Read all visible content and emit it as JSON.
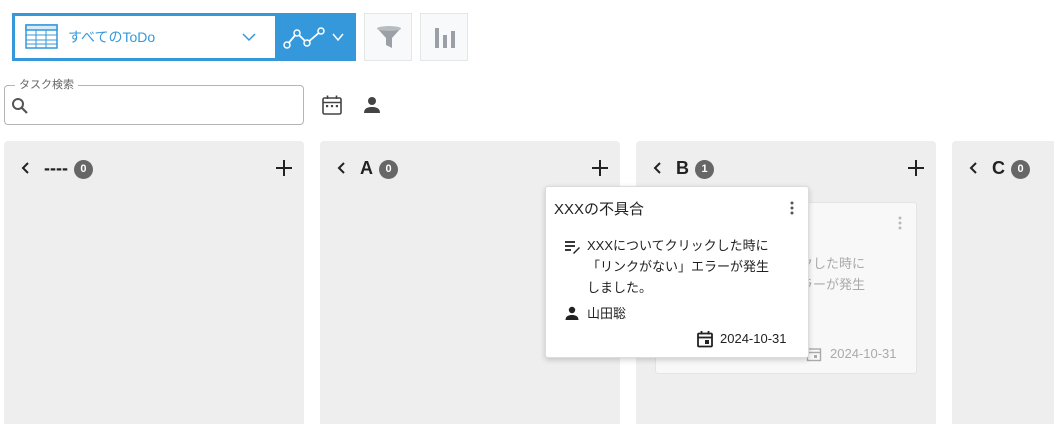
{
  "toolbar": {
    "view_label": "すべてのToDo",
    "view_icon": "table-icon",
    "graph_icon": "line-graph-icon",
    "filter_icon": "funnel-icon",
    "chart_icon": "bar-chart-icon",
    "accent_color": "#3498db"
  },
  "search": {
    "legend": "タスク検索",
    "value": "",
    "placeholder": ""
  },
  "columns": [
    {
      "title": "----",
      "count": "0"
    },
    {
      "title": "A",
      "count": "0"
    },
    {
      "title": "B",
      "count": "1"
    },
    {
      "title": "C",
      "count": "0"
    }
  ],
  "ghost_card": {
    "line1": "ックした時に",
    "line2": "エラーが発生",
    "date": "2024-10-31"
  },
  "drag_card": {
    "title": "XXXの不具合",
    "description": "XXXについてクリックした時に\n「リンクがない」エラーが発生\nしました。",
    "assignee": "山田聡",
    "due_date": "2024-10-31"
  }
}
